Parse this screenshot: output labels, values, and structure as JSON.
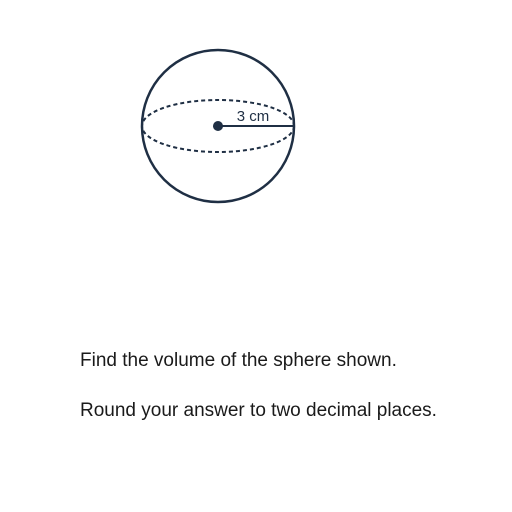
{
  "diagram": {
    "radius_label": "3 cm",
    "stroke_color": "#1f2f44"
  },
  "question": {
    "line_1": "Find the volume of the sphere shown.",
    "line_2": "Round your answer to two decimal places."
  }
}
